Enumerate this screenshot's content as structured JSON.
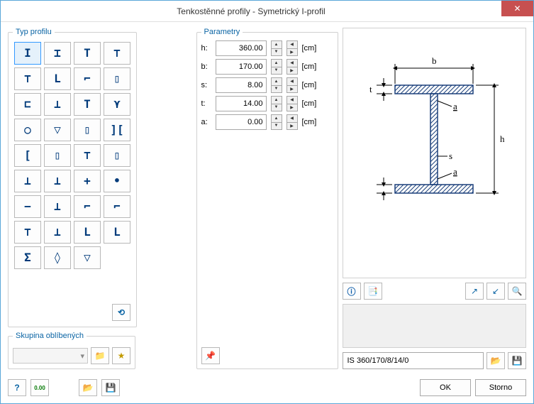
{
  "window": {
    "title": "Tenkostěnné profily - Symetrický I-profil"
  },
  "profile_types": {
    "legend": "Typ profilu",
    "items": [
      "I",
      "⌶",
      "T",
      "⊤",
      "⊤",
      "L",
      "⌐",
      "▯",
      "⊏",
      "⊥",
      "T",
      "⋎",
      "○",
      "▽",
      "▯",
      "][",
      "[",
      "▯",
      "⊤",
      "▯",
      "⊥",
      "⊥",
      "+",
      "•",
      "−",
      "⊥",
      "⌐",
      "⌐",
      "⊤",
      "⊥",
      "L",
      "L",
      "Σ",
      "◊",
      "▽",
      " "
    ],
    "selected_index": 0
  },
  "favorites": {
    "legend": "Skupina oblíbených",
    "selected": ""
  },
  "parameters": {
    "legend": "Parametry",
    "rows": [
      {
        "label": "h:",
        "value": "360.00",
        "unit": "[cm]"
      },
      {
        "label": "b:",
        "value": "170.00",
        "unit": "[cm]"
      },
      {
        "label": "s:",
        "value": "8.00",
        "unit": "[cm]"
      },
      {
        "label": "t:",
        "value": "14.00",
        "unit": "[cm]"
      },
      {
        "label": "a:",
        "value": "0.00",
        "unit": "[cm]"
      }
    ]
  },
  "preview": {
    "labels": {
      "b": "b",
      "h": "h",
      "s": "s",
      "t": "t",
      "a": "a"
    }
  },
  "profile_name": "IS 360/170/8/14/0",
  "buttons": {
    "ok": "OK",
    "cancel": "Storno"
  },
  "icons": {
    "reset": "↺",
    "folder": "📁",
    "star": "★",
    "pin": "📌",
    "info": "ℹ",
    "copy": "📑",
    "axis1": "↗",
    "axis2": "↙",
    "zoom": "🔍",
    "open": "📂",
    "save": "💾",
    "help": "?",
    "tol": "0.00"
  }
}
